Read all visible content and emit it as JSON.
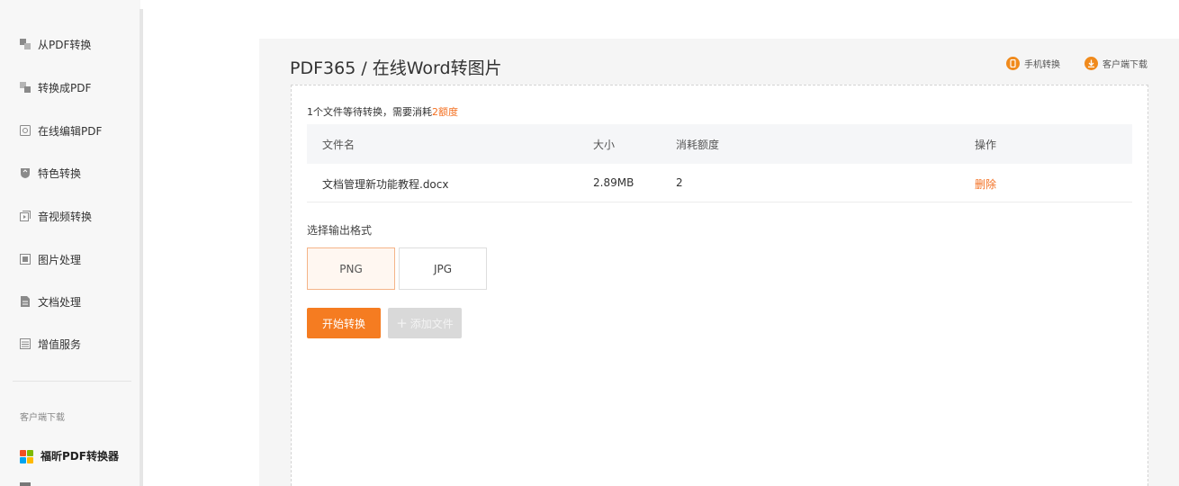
{
  "sidebar": {
    "items": [
      {
        "label": "从PDF转换",
        "icon": "from-pdf-icon"
      },
      {
        "label": "转换成PDF",
        "icon": "to-pdf-icon"
      },
      {
        "label": "在线编辑PDF",
        "icon": "edit-pdf-icon"
      },
      {
        "label": "特色转换",
        "icon": "shield-icon"
      },
      {
        "label": "音视频转换",
        "icon": "media-icon"
      },
      {
        "label": "图片处理",
        "icon": "image-icon"
      },
      {
        "label": "文档处理",
        "icon": "document-icon"
      },
      {
        "label": "增值服务",
        "icon": "list-icon"
      }
    ],
    "section_label": "客户端下载",
    "brand": {
      "label": "福昕PDF转换器",
      "icon": "windows-logo-icon"
    }
  },
  "header": {
    "title": "PDF365 / 在线Word转图片",
    "mobile_link": "手机转换",
    "download_link": "客户端下载"
  },
  "notice": {
    "prefix": "1个文件等待转换，需要消耗",
    "count": "2额度"
  },
  "table": {
    "columns": {
      "name": "文件名",
      "size": "大小",
      "cost": "消耗额度",
      "action": "操作"
    },
    "rows": [
      {
        "name": "文档管理新功能教程.docx",
        "size": "2.89MB",
        "cost": "2",
        "action": "删除"
      }
    ]
  },
  "format": {
    "label": "选择输出格式",
    "options": [
      "PNG",
      "JPG"
    ],
    "selected": "PNG"
  },
  "actions": {
    "start": "开始转换",
    "add": "添加文件"
  },
  "colors": {
    "accent": "#f57c21",
    "highlight": "#f36f20",
    "disabled": "#d9d9d9"
  }
}
